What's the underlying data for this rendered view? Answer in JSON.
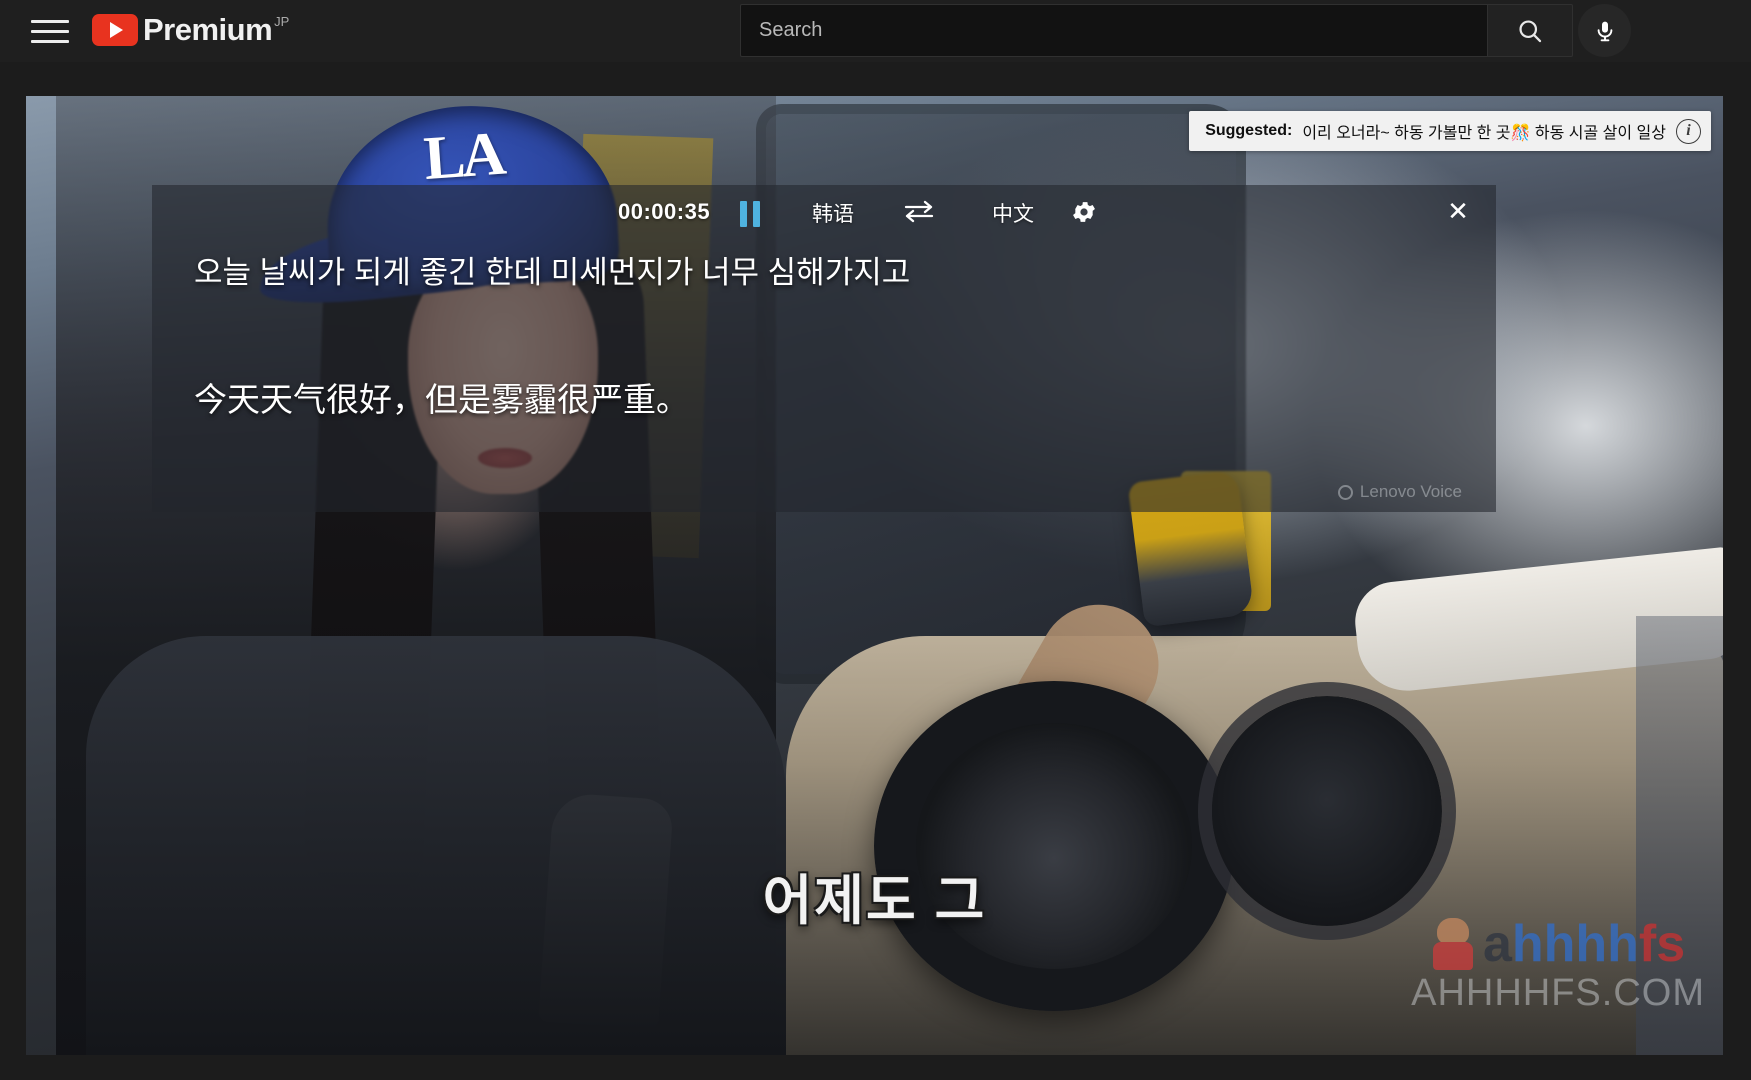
{
  "topbar": {
    "menu_icon": "hamburger-icon",
    "logo_text": "Premium",
    "logo_country": "JP",
    "play_icon": "youtube-play-icon",
    "search_placeholder": "Search",
    "search_value": "",
    "search_icon": "search-icon",
    "mic_icon": "microphone-icon"
  },
  "suggested": {
    "label": "Suggested:",
    "text": "이리 오너라~ 하동 가볼만 한 곳🎊 하동 시골 살이 일상",
    "info_icon": "info-icon"
  },
  "overlay": {
    "timestamp": "00:00:35",
    "pause_icon": "pause-icon",
    "source_language": "韩语",
    "swap_icon": "swap-arrows-icon",
    "target_language": "中文",
    "settings_icon": "gear-icon",
    "close_icon": "close-icon",
    "subtitle_source": "오늘 날씨가 되게 좋긴 한데 미세먼지가 너무 심해가지고",
    "subtitle_target": "今天天气很好，但是雾霾很严重。",
    "watermark": "Lenovo Voice"
  },
  "video": {
    "burned_in_subtitle": "어제도 그"
  },
  "site_watermark": {
    "word_a": "a",
    "word_b": "hhhh",
    "word_c": "fs",
    "domain": "AHHHHFS.COM",
    "mascot_icon": "mascot-icon"
  },
  "colors": {
    "chrome_bg": "#1f1f1f",
    "youtube_red": "#e8331f",
    "pause_blue": "#4fb3e0",
    "suggested_bg": "#f1f1f1",
    "overlay_bg": "rgba(34,38,45,0.58)"
  }
}
